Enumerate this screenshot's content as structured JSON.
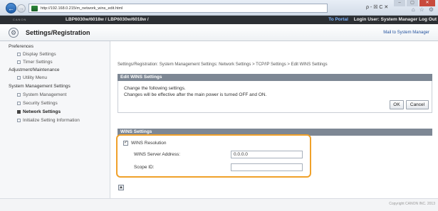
{
  "browser": {
    "url": "http://192.168.0.215/m_network_wins_edit.html",
    "search_glyph": "ρ - ☒ C ✕",
    "window_controls": [
      "–",
      "▢",
      "✕"
    ],
    "toolbar_icons": [
      "⌂",
      "☆",
      "⚙"
    ]
  },
  "device_bar": {
    "logo": "CANON",
    "device_name": "LBP6030w/6018w / LBP6030w/6018w /",
    "portal_link": "To Portal",
    "login_text": "Login User: System Manager Log Out"
  },
  "title_bar": {
    "title": "Settings/Registration",
    "mail_link": "Mail to System Manager"
  },
  "sidebar": {
    "sections": [
      {
        "heading": "Preferences",
        "items": [
          "Display Settings",
          "Timer Settings"
        ]
      },
      {
        "heading": "Adjustment/Maintenance",
        "items": [
          "Utility Menu"
        ]
      },
      {
        "heading": "System Management Settings",
        "items": [
          "System Management",
          "Security Settings",
          "Network Settings",
          "Initialize Setting Information"
        ]
      }
    ],
    "active_item": "Network Settings"
  },
  "main": {
    "breadcrumb": "Settings/Registration: System Management Settings: Network Settings > TCP/IP Settings > Edit WINS Settings",
    "edit_panel": {
      "title": "Edit WINS Settings",
      "instruction_1": "Change the following settings.",
      "instruction_2": "Changes will be effective after the main power is turned OFF and ON.",
      "ok_label": "OK",
      "cancel_label": "Cancel"
    },
    "wins_panel": {
      "title": "WINS Settings",
      "resolution_label": "WINS Resolution",
      "resolution_checked": true,
      "server_address_label": "WINS Server Address:",
      "server_address_value": "0.0.0.0",
      "scope_id_label": "Scope ID:",
      "scope_id_value": ""
    }
  },
  "footer": {
    "copyright": "Copyright CANON INC. 2013"
  },
  "colors": {
    "highlight": "#f0a12a",
    "panel_header": "#7d8794",
    "device_bar": "#2c2f33"
  }
}
